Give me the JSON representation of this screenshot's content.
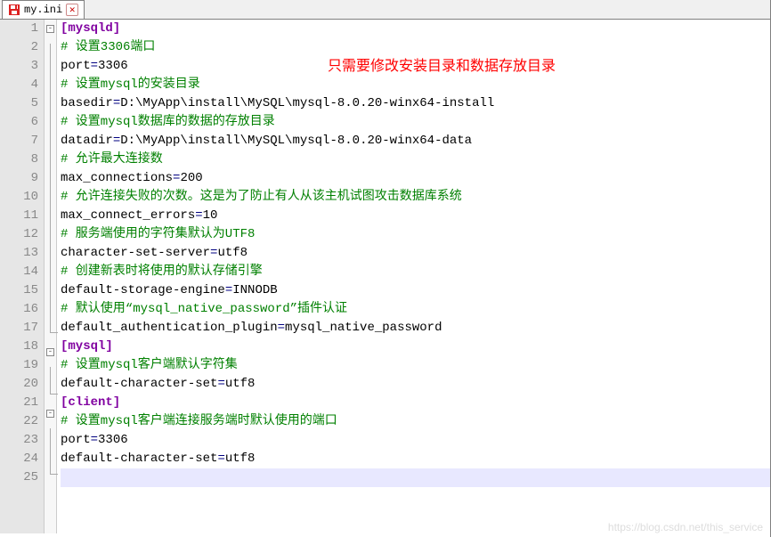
{
  "tab": {
    "filename": "my.ini"
  },
  "annotation": "只需要修改安装目录和数据存放目录",
  "watermark": "https://blog.csdn.net/this_service",
  "lines": [
    {
      "n": 1,
      "fold": "box",
      "type": "section",
      "content": "[mysqld]"
    },
    {
      "n": 2,
      "fold": "line",
      "type": "comment",
      "content": "# 设置3306端口"
    },
    {
      "n": 3,
      "fold": "line",
      "type": "kv",
      "key": "port",
      "val": "3306",
      "hasAnnot": true
    },
    {
      "n": 4,
      "fold": "line",
      "type": "comment",
      "content": "# 设置mysql的安装目录"
    },
    {
      "n": 5,
      "fold": "line",
      "type": "kv",
      "key": "basedir",
      "val": "D:\\MyApp\\install\\MySQL\\mysql-8.0.20-winx64-install"
    },
    {
      "n": 6,
      "fold": "line",
      "type": "comment",
      "content": "# 设置mysql数据库的数据的存放目录"
    },
    {
      "n": 7,
      "fold": "line",
      "type": "kv",
      "key": "datadir",
      "val": "D:\\MyApp\\install\\MySQL\\mysql-8.0.20-winx64-data"
    },
    {
      "n": 8,
      "fold": "line",
      "type": "comment",
      "content": "# 允许最大连接数"
    },
    {
      "n": 9,
      "fold": "line",
      "type": "kv",
      "key": "max_connections",
      "val": "200"
    },
    {
      "n": 10,
      "fold": "line",
      "type": "comment",
      "content": "# 允许连接失败的次数。这是为了防止有人从该主机试图攻击数据库系统"
    },
    {
      "n": 11,
      "fold": "line",
      "type": "kv",
      "key": "max_connect_errors",
      "val": "10"
    },
    {
      "n": 12,
      "fold": "line",
      "type": "comment",
      "content": "# 服务端使用的字符集默认为UTF8"
    },
    {
      "n": 13,
      "fold": "line",
      "type": "kv",
      "key": "character-set-server",
      "val": "utf8"
    },
    {
      "n": 14,
      "fold": "line",
      "type": "comment",
      "content": "# 创建新表时将使用的默认存储引擎"
    },
    {
      "n": 15,
      "fold": "line",
      "type": "kv",
      "key": "default-storage-engine",
      "val": "INNODB"
    },
    {
      "n": 16,
      "fold": "line",
      "type": "comment",
      "content": "# 默认使用“mysql_native_password”插件认证"
    },
    {
      "n": 17,
      "fold": "end",
      "type": "kv",
      "key": "default_authentication_plugin",
      "val": "mysql_native_password"
    },
    {
      "n": 18,
      "fold": "box",
      "type": "section",
      "content": "[mysql]"
    },
    {
      "n": 19,
      "fold": "line",
      "type": "comment",
      "content": "# 设置mysql客户端默认字符集"
    },
    {
      "n": 20,
      "fold": "end",
      "type": "kv",
      "key": "default-character-set",
      "val": "utf8"
    },
    {
      "n": 21,
      "fold": "box",
      "type": "section",
      "content": "[client]"
    },
    {
      "n": 22,
      "fold": "line",
      "type": "comment",
      "content": "# 设置mysql客户端连接服务端时默认使用的端口"
    },
    {
      "n": 23,
      "fold": "line",
      "type": "kv",
      "key": "port",
      "val": "3306"
    },
    {
      "n": 24,
      "fold": "end",
      "type": "kv",
      "key": "default-character-set",
      "val": "utf8"
    },
    {
      "n": 25,
      "fold": "",
      "type": "empty",
      "caret": true
    }
  ]
}
